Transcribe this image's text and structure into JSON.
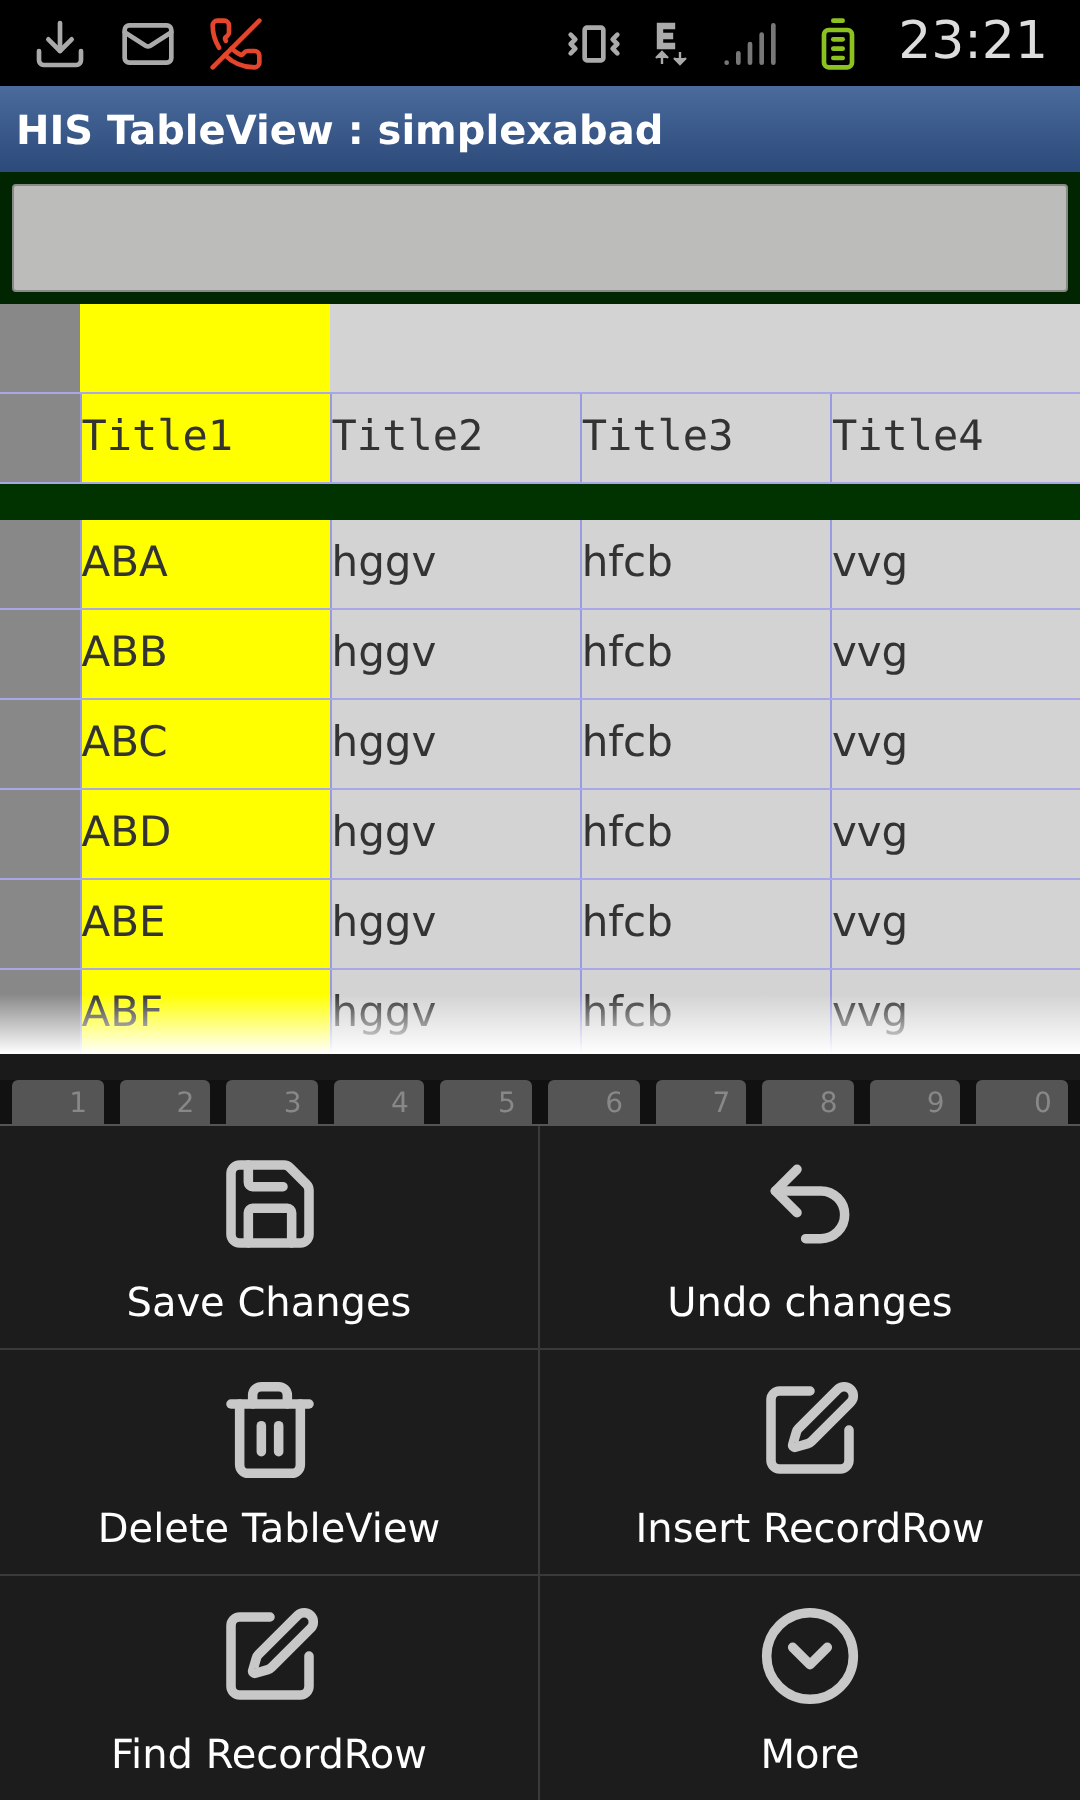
{
  "status_bar": {
    "time": "23:21"
  },
  "window": {
    "title": "HIS TableView : simplexabad"
  },
  "table": {
    "columns": [
      {
        "title": "Title1",
        "highlighted": true
      },
      {
        "title": "Title2",
        "highlighted": false
      },
      {
        "title": "Title3",
        "highlighted": false
      },
      {
        "title": "Title4",
        "highlighted": false
      }
    ],
    "rows": [
      {
        "cells": [
          "ABA",
          "hggv",
          "hfcb",
          "vvg"
        ]
      },
      {
        "cells": [
          "ABB",
          "hggv",
          "hfcb",
          "vvg"
        ]
      },
      {
        "cells": [
          "ABC",
          "hggv",
          "hfcb",
          "vvg"
        ]
      },
      {
        "cells": [
          "ABD",
          "hggv",
          "hfcb",
          "vvg"
        ]
      },
      {
        "cells": [
          "ABE",
          "hggv",
          "hfcb",
          "vvg"
        ]
      },
      {
        "cells": [
          "ABF",
          "hggv",
          "hfcb",
          "vvg"
        ]
      }
    ]
  },
  "keyboard_keys": [
    "1",
    "2",
    "3",
    "4",
    "5",
    "6",
    "7",
    "8",
    "9",
    "0"
  ],
  "menu": [
    {
      "label": "Save Changes"
    },
    {
      "label": "Undo changes"
    },
    {
      "label": "Delete TableView"
    },
    {
      "label": "Insert RecordRow"
    },
    {
      "label": "Find RecordRow"
    },
    {
      "label": "More"
    }
  ]
}
